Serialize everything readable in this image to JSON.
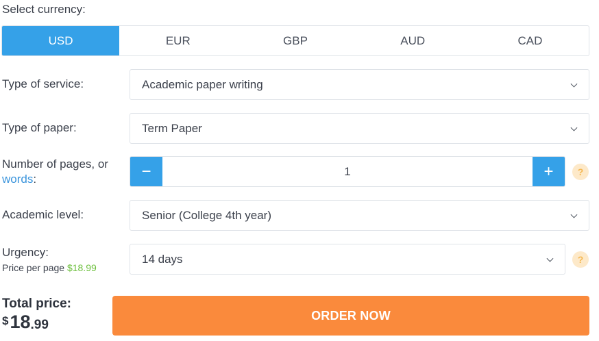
{
  "currency": {
    "label": "Select currency:",
    "options": [
      "USD",
      "EUR",
      "GBP",
      "AUD",
      "CAD"
    ],
    "selected": "USD"
  },
  "service": {
    "label": "Type of service:",
    "value": "Academic paper writing"
  },
  "paper": {
    "label": "Type of paper:",
    "value": "Term Paper"
  },
  "pages": {
    "label": "Number of pages, or",
    "link": "words",
    "colon": ":",
    "value": "1",
    "minus": "−",
    "plus": "+",
    "help": "?"
  },
  "level": {
    "label": "Academic level:",
    "value": "Senior (College 4th year)"
  },
  "urgency": {
    "label": "Urgency:",
    "price_per_page_label": "Price per page",
    "price_per_page": "$18.99",
    "value": "14 days",
    "help": "?"
  },
  "total": {
    "label": "Total price:",
    "currency_symbol": "$",
    "integer": "18",
    "decimal": ".99"
  },
  "order_button": "ORDER NOW",
  "colors": {
    "accent_blue": "#35a1e8",
    "order_orange": "#fa8a3c",
    "price_green": "#6cbf3c",
    "help_bg": "#fde9c9"
  }
}
